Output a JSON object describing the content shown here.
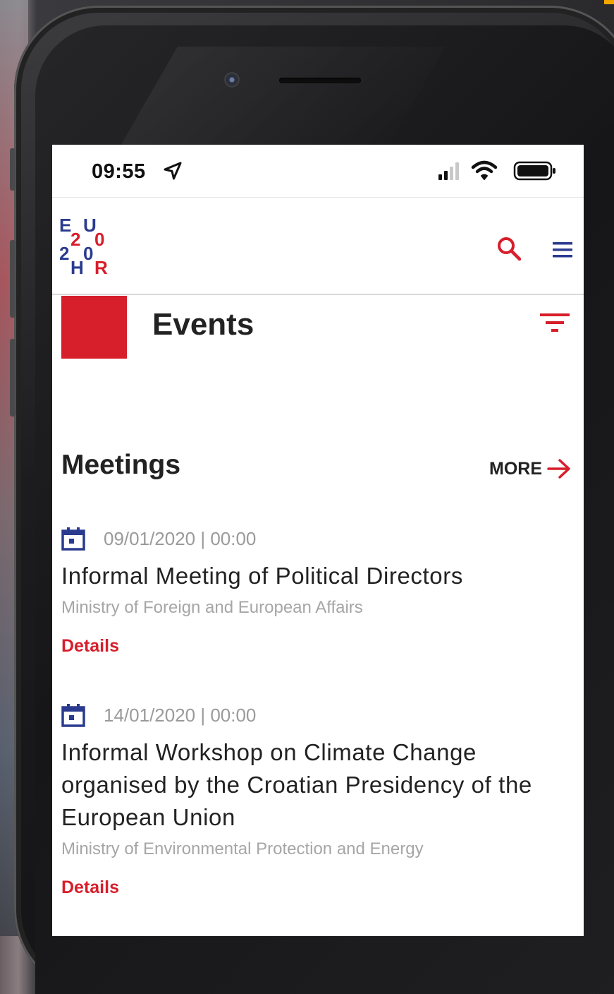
{
  "status_bar": {
    "time": "09:55"
  },
  "header": {
    "logo": {
      "letters": [
        "E",
        "U",
        "2",
        "0",
        "2",
        "0",
        "H",
        "R"
      ],
      "colors": {
        "blue": "#2a3b8f",
        "red": "#d71e2b"
      }
    },
    "icons": [
      "search-icon",
      "menu-icon"
    ]
  },
  "page": {
    "title": "Events",
    "filter_icon": "filter-icon"
  },
  "section": {
    "title": "Meetings",
    "more_label": "MORE"
  },
  "events": [
    {
      "date": "09/01/2020 | 00:00",
      "title": "Informal Meeting of Political Directors",
      "organizer": "Ministry of Foreign and European Affairs",
      "details_label": "Details"
    },
    {
      "date": "14/01/2020 | 00:00",
      "title": "Informal Workshop on Climate Change organised by the Croatian Presidency of the European Union",
      "organizer": "Ministry of Environmental Protection and Energy",
      "details_label": "Details"
    }
  ],
  "colors": {
    "accent": "#d71e2b",
    "brand_blue": "#2a3b8f",
    "text": "#222222",
    "muted": "#9a9a9a"
  }
}
